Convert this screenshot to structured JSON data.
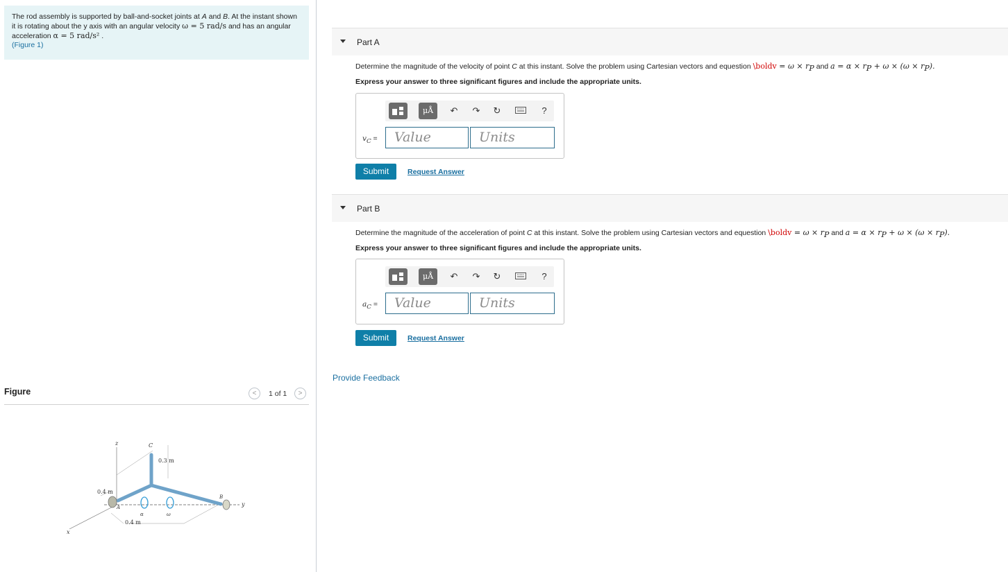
{
  "problem": {
    "text_part1": "The rod assembly is supported by ball-and-socket joints at ",
    "point_a": "A",
    "text_and": " and ",
    "point_b": "B",
    "text_part2": ". At the instant shown it is rotating about the y axis with an angular velocity ",
    "omega_expr": "ω = 5 rad/s",
    "text_part3": " and has an angular acceleration ",
    "alpha_expr": "α = 5 rad/s²",
    "text_end": " .",
    "figure_link": "(Figure 1)"
  },
  "figure": {
    "title": "Figure",
    "counter": "1 of 1",
    "prev_glyph": "<",
    "next_glyph": ">",
    "labels": {
      "z": "z",
      "c": "C",
      "dim_03": "0.3 m",
      "dim_04_top": "0.4 m",
      "a": "A",
      "b": "B",
      "y": "y",
      "alpha": "α",
      "omega": "ω",
      "dim_04_bottom": "0.4 m",
      "x": "x"
    }
  },
  "parts": [
    {
      "title": "Part A",
      "question_pre": "Determine the magnitude of the velocity of point ",
      "point": "C",
      "question_mid": " at this instant. Solve the problem using Cartesian vectors and equestion ",
      "eq_red": "\\boldv",
      "eq1": " = ω × r",
      "eq1_sub": "P",
      "eq_and": " and ",
      "eq2": "a = α × r",
      "eq2_sub": "P",
      "eq3": " + ω × (ω × r",
      "eq3_sub": "P",
      "eq_end": ").",
      "express": "Express your answer to three significant figures and include the appropriate units.",
      "var_label": "v",
      "var_sub": "C",
      "var_eq": " =",
      "value_placeholder": "Value",
      "units_placeholder": "Units",
      "submit": "Submit",
      "request": "Request Answer"
    },
    {
      "title": "Part B",
      "question_pre": "Determine the magnitude of the acceleration of point ",
      "point": "C",
      "question_mid": " at this instant. Solve the problem using Cartesian vectors and equestion ",
      "eq_red": "\\boldv",
      "eq1": " = ω × r",
      "eq1_sub": "P",
      "eq_and": " and ",
      "eq2": "a = α × r",
      "eq2_sub": "P",
      "eq3": " + ω × (ω × r",
      "eq3_sub": "P",
      "eq_end": ").",
      "express": "Express your answer to three significant figures and include the appropriate units.",
      "var_label": "a",
      "var_sub": "C",
      "var_eq": " =",
      "value_placeholder": "Value",
      "units_placeholder": "Units",
      "submit": "Submit",
      "request": "Request Answer"
    }
  ],
  "toolbar": {
    "template_icon": "template-icon",
    "units_glyph": "μÅ",
    "undo_glyph": "↶",
    "redo_glyph": "↷",
    "reset_glyph": "↻",
    "keyboard_icon": "keyboard-icon",
    "help_glyph": "?"
  },
  "feedback": "Provide Feedback",
  "colors": {
    "problem_bg": "#e6f4f6",
    "submit_bg": "#0f7fa8",
    "link": "#1a6fa0",
    "eq_red": "#d00000"
  }
}
